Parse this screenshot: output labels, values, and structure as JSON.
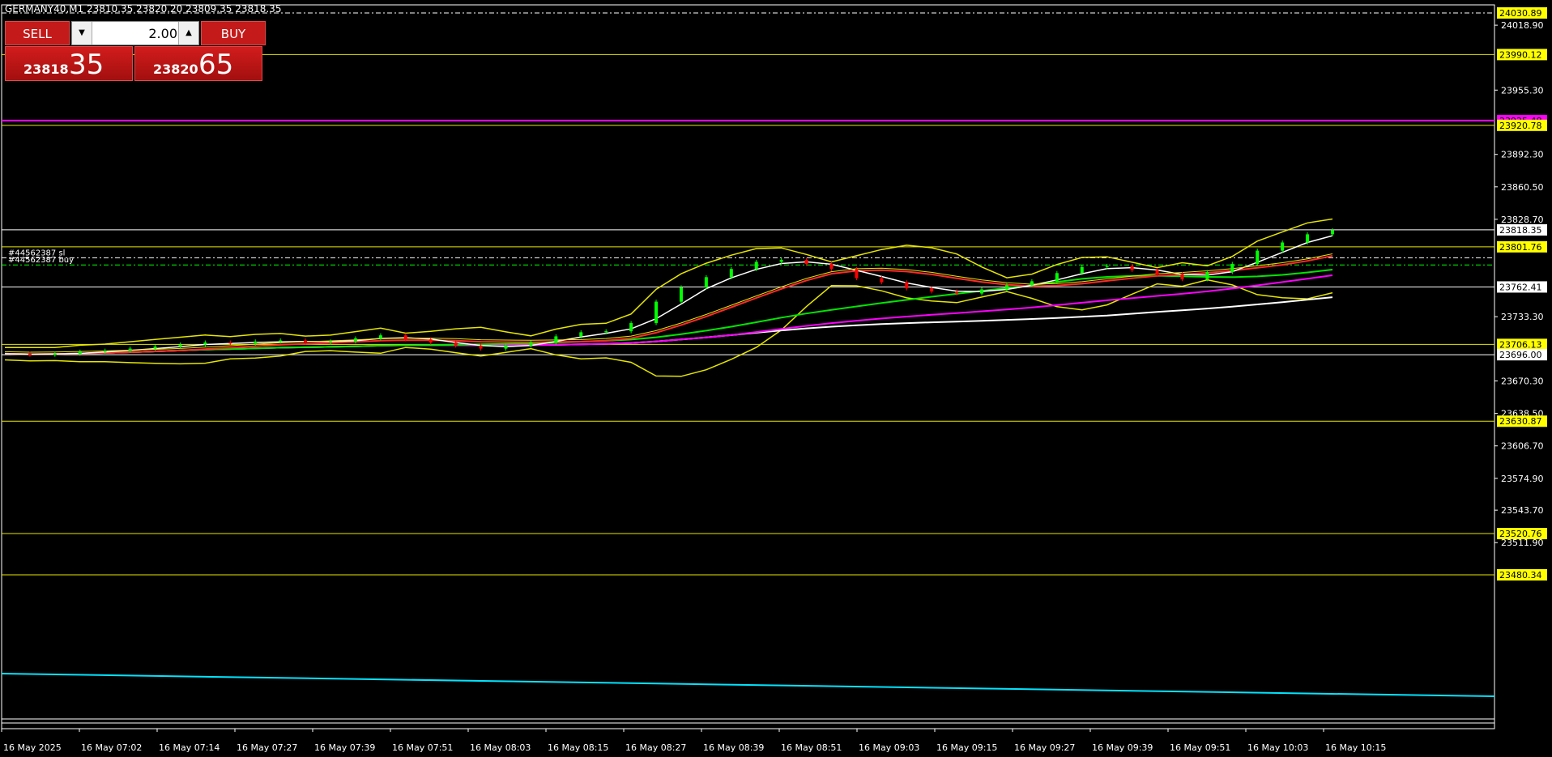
{
  "symbol_info": "GERMANY40,M1  23810.35 23820.20 23809.35 23818.35",
  "trade_panel": {
    "sell_label": "SELL",
    "buy_label": "BUY",
    "lot": "2.00",
    "sell_price_main": "23818",
    "sell_price_pips": "35",
    "buy_price_main": "23820",
    "buy_price_pips": "65"
  },
  "colors": {
    "background": "#000000",
    "grid_line": "#ffffff",
    "level_line": "#e6e600",
    "magenta": "#ff00ff",
    "cyan": "#00e5ff",
    "bull_candle": "#00ff00",
    "bear_candle": "#ff0000",
    "label_bg": "#ffff00"
  },
  "chart_data": {
    "type": "line",
    "ylim": [
      23460,
      24040
    ],
    "y_ticks": [
      "24018.90",
      "23955.30",
      "23892.30",
      "23860.50",
      "23828.70",
      "23733.30",
      "23670.30",
      "23638.50",
      "23606.70",
      "23574.90",
      "23543.70",
      "23511.90"
    ],
    "x_ticks": [
      "16 May 2025",
      "16 May 07:02",
      "16 May 07:14",
      "16 May 07:27",
      "16 May 07:39",
      "16 May 07:51",
      "16 May 08:03",
      "16 May 08:15",
      "16 May 08:27",
      "16 May 08:39",
      "16 May 08:51",
      "16 May 09:03",
      "16 May 09:15",
      "16 May 09:27",
      "16 May 09:39",
      "16 May 09:51",
      "16 May 10:03",
      "16 May 10:15"
    ],
    "levels": [
      {
        "value": 24030.89,
        "label": "24030.89",
        "style": "dashed"
      },
      {
        "value": 23990.12,
        "label": "23990.12",
        "style": "solid"
      },
      {
        "value": 23925.48,
        "label": "23925.48",
        "style": "magenta"
      },
      {
        "value": 23920.78,
        "label": "23920.78",
        "style": "solid"
      },
      {
        "value": 23818.35,
        "label": "23818.35",
        "style": "white"
      },
      {
        "value": 23801.76,
        "label": "23801.76",
        "style": "solid"
      },
      {
        "value": 23762.41,
        "label": "23762.41",
        "style": "white"
      },
      {
        "value": 23706.13,
        "label": "23706.13",
        "style": "solid"
      },
      {
        "value": 23696.0,
        "label": "23696.00",
        "style": "white"
      },
      {
        "value": 23630.87,
        "label": "23630.87",
        "style": "solid"
      },
      {
        "value": 23520.76,
        "label": "23520.76",
        "style": "solid"
      },
      {
        "value": 23480.34,
        "label": "23480.34",
        "style": "solid"
      }
    ],
    "order_lines": [
      {
        "label": "#44562387 sl",
        "value": 23791.0
      },
      {
        "label": "#44562387 buy",
        "value": 23784.0
      }
    ],
    "close_series": [
      23697,
      23696,
      23697,
      23699,
      23700,
      23702,
      23704,
      23706,
      23708,
      23707,
      23709,
      23710,
      23708,
      23709,
      23712,
      23715,
      23711,
      23708,
      23705,
      23702,
      23705,
      23708,
      23714,
      23718,
      23719,
      23727,
      23748,
      23762,
      23772,
      23780,
      23787,
      23789,
      23785,
      23780,
      23771,
      23767,
      23761,
      23758,
      23756,
      23760,
      23764,
      23768,
      23776,
      23782,
      23783,
      23779,
      23775,
      23770,
      23777,
      23785,
      23798,
      23806,
      23814,
      23818
    ]
  }
}
